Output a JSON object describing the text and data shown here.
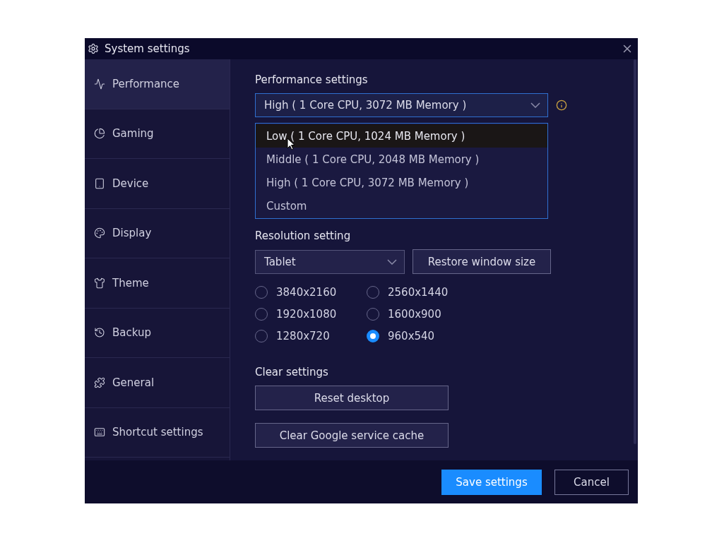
{
  "window": {
    "title": "System settings"
  },
  "sidebar": {
    "items": [
      {
        "label": "Performance",
        "selected": true
      },
      {
        "label": "Gaming",
        "selected": false
      },
      {
        "label": "Device",
        "selected": false
      },
      {
        "label": "Display",
        "selected": false
      },
      {
        "label": "Theme",
        "selected": false
      },
      {
        "label": "Backup",
        "selected": false
      },
      {
        "label": "General",
        "selected": false
      },
      {
        "label": "Shortcut settings",
        "selected": false
      }
    ]
  },
  "performance": {
    "heading": "Performance settings",
    "select": {
      "value": "High ( 1 Core CPU, 3072 MB Memory )",
      "expanded": true
    },
    "options": [
      {
        "label": "Low ( 1 Core CPU, 1024 MB Memory )",
        "highlighted": true
      },
      {
        "label": "Middle ( 1 Core CPU, 2048 MB Memory )",
        "highlighted": false
      },
      {
        "label": "High ( 1 Core CPU, 3072 MB Memory )",
        "highlighted": false
      },
      {
        "label": "Custom",
        "highlighted": false
      }
    ]
  },
  "resolution": {
    "heading": "Resolution setting",
    "select": {
      "value": "Tablet"
    },
    "restore_button": "Restore window size",
    "options": [
      {
        "label": "3840x2160",
        "selected": false
      },
      {
        "label": "2560x1440",
        "selected": false
      },
      {
        "label": "1920x1080",
        "selected": false
      },
      {
        "label": "1600x900",
        "selected": false
      },
      {
        "label": "1280x720",
        "selected": false
      },
      {
        "label": "960x540",
        "selected": true
      }
    ]
  },
  "clear": {
    "heading": "Clear settings",
    "buttons": [
      "Reset desktop",
      "Clear Google service cache"
    ]
  },
  "footer": {
    "buttons": [
      {
        "label": "Save settings",
        "kind": "primary"
      },
      {
        "label": "Cancel",
        "kind": "secondary"
      }
    ]
  }
}
